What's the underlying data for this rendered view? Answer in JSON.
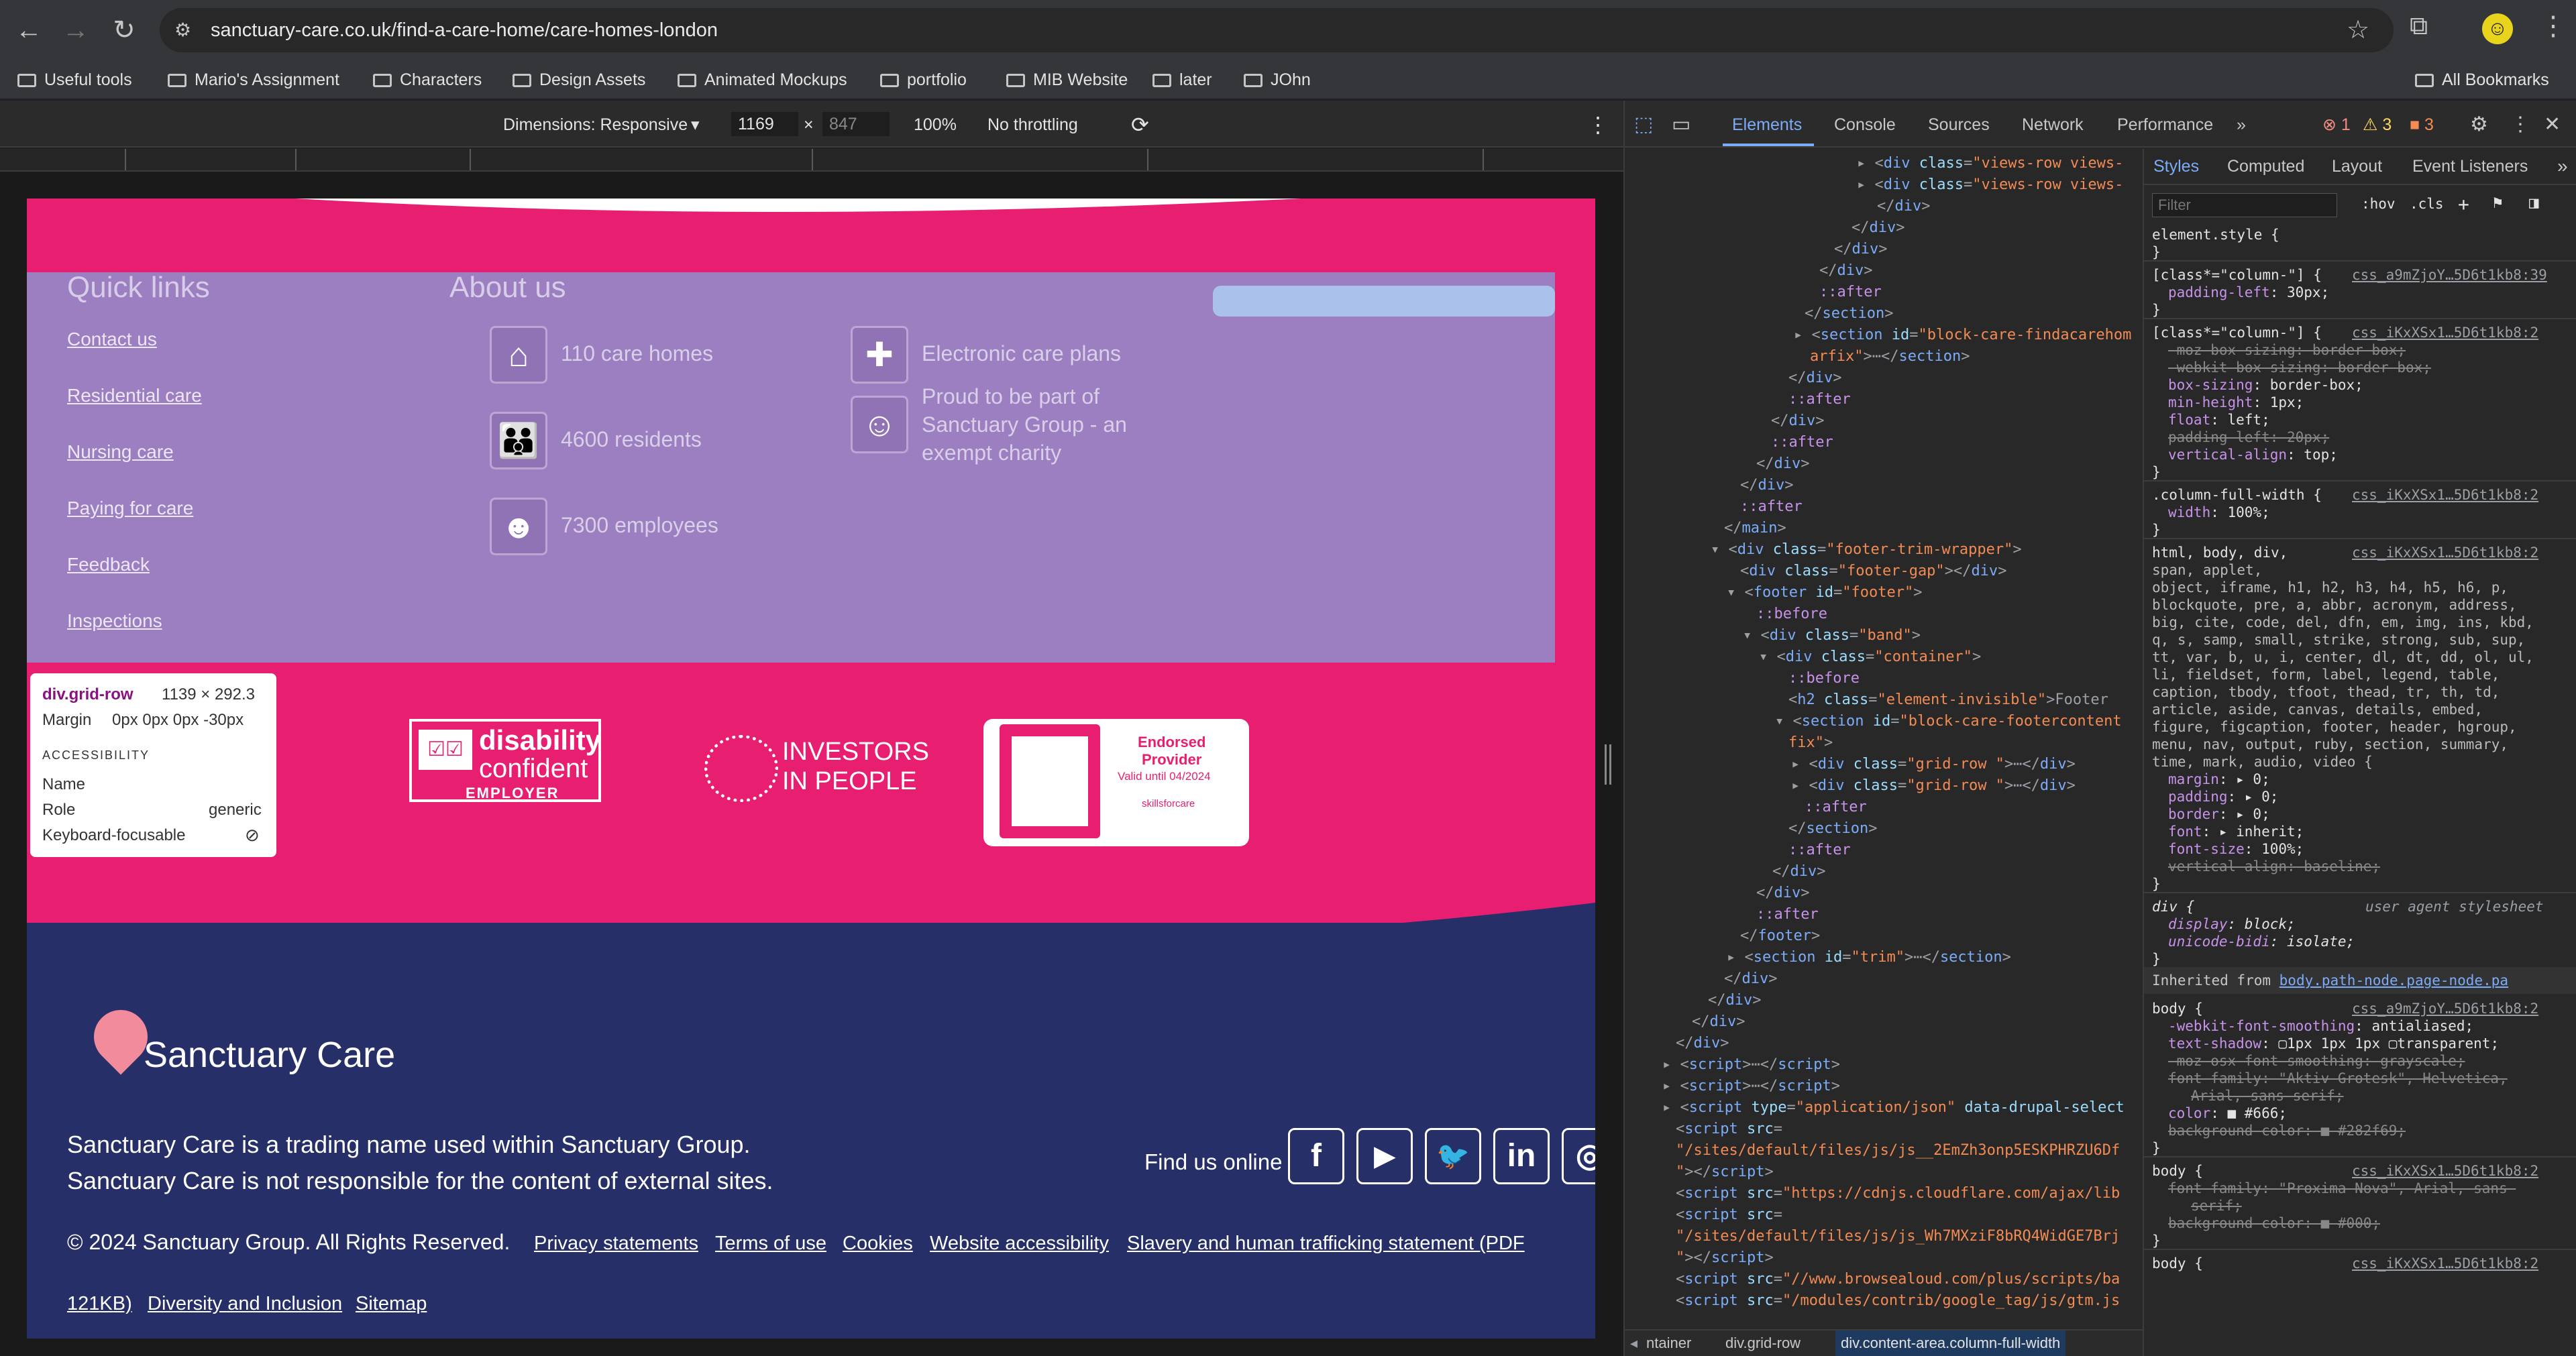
{
  "browser": {
    "url": "sanctuary-care.co.uk/find-a-care-home/care-homes-london",
    "bookmarks": [
      "Useful tools",
      "Mario's Assignment",
      "Characters",
      "Design Assets",
      "Animated Mockups",
      "portfolio",
      "MIB Website",
      "later",
      "JOhn"
    ],
    "all_bookmarks": "All Bookmarks"
  },
  "device_toolbar": {
    "dimensions": "Dimensions: Responsive",
    "width": "1169",
    "height": "847",
    "zoom": "100%",
    "throttling": "No throttling"
  },
  "page": {
    "quick_links_title": "Quick links",
    "about_title": "About us",
    "quick_links": [
      "Contact us",
      "Residential care",
      "Nursing care",
      "Paying for care",
      "Feedback",
      "Inspections"
    ],
    "stats": [
      "110 care homes",
      "4600 residents",
      "7300 employees"
    ],
    "about_items": [
      "Electronic care plans",
      "Proud to be part of",
      "Sanctuary Group - an",
      "exempt charity"
    ],
    "tooltip": {
      "selector": "div.grid-row",
      "size": "1139 × 292.3",
      "margin_label": "Margin",
      "margin_value": "0px 0px 0px -30px",
      "section": "ACCESSIBILITY",
      "name_label": "Name",
      "role_label": "Role",
      "role_value": "generic",
      "focus_label": "Keyboard-focusable"
    },
    "badges": {
      "disability_1": "disability",
      "disability_2": "confident",
      "disability_3": "EMPLOYER",
      "iip_1": "INVESTORS",
      "iip_2": "IN PEOPLE",
      "endorsed_1": "Endorsed",
      "endorsed_2": "Provider",
      "endorsed_3": "Valid until 04/2024",
      "endorsed_4": "skillsforcare"
    },
    "brand": "Sanctuary Care",
    "footer_line1": "Sanctuary Care is a trading name used within Sanctuary Group.",
    "footer_line2": "Sanctuary Care is not responsible for the content of external sites.",
    "find_us": "Find us online",
    "copyright": "© 2024 Sanctuary Group. All Rights Reserved.",
    "footer_links": [
      "Privacy statements",
      "Terms of use",
      "Cookies",
      "Website accessibility",
      "Slavery and human trafficking statement (PDF",
      "121KB)",
      "Diversity and Inclusion",
      "Sitemap"
    ],
    "colors": {
      "pink": "#e81f70",
      "purple": "#9c7fc0",
      "navy": "#272f68"
    }
  },
  "devtools": {
    "tabs": [
      "Elements",
      "Console",
      "Sources",
      "Network",
      "Performance"
    ],
    "issues": {
      "errors": "1",
      "warnings": "3",
      "info": "3"
    },
    "style_tabs": [
      "Styles",
      "Computed",
      "Layout",
      "Event Listeners"
    ],
    "filter_placeholder": "Filter",
    "hov": ":hov",
    "cls": ".cls",
    "breadcrumbs": [
      "ntainer",
      "div.grid-row",
      "div.content-area.column-full-width"
    ]
  }
}
